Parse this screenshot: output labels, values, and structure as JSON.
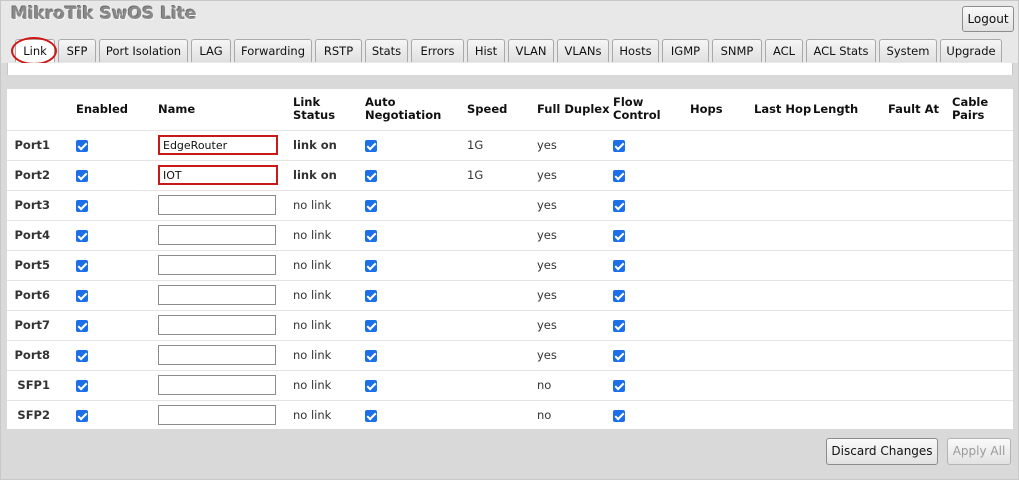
{
  "app": {
    "title": "MikroTik SwOS Lite",
    "logout_label": "Logout"
  },
  "tabs": [
    {
      "label": "Link",
      "active": true
    },
    {
      "label": "SFP"
    },
    {
      "label": "Port Isolation"
    },
    {
      "label": "LAG"
    },
    {
      "label": "Forwarding"
    },
    {
      "label": "RSTP"
    },
    {
      "label": "Stats"
    },
    {
      "label": "Errors"
    },
    {
      "label": "Hist"
    },
    {
      "label": "VLAN"
    },
    {
      "label": "VLANs"
    },
    {
      "label": "Hosts"
    },
    {
      "label": "IGMP"
    },
    {
      "label": "SNMP"
    },
    {
      "label": "ACL"
    },
    {
      "label": "ACL Stats"
    },
    {
      "label": "System"
    },
    {
      "label": "Upgrade"
    }
  ],
  "table": {
    "columns": {
      "enabled": "Enabled",
      "name": "Name",
      "link_status": "Link Status",
      "auto_negotiation": "Auto Negotiation",
      "speed": "Speed",
      "full_duplex": "Full Duplex",
      "flow_control": "Flow Control",
      "hops": "Hops",
      "last_hop": "Last Hop",
      "length": "Length",
      "fault_at": "Fault At",
      "cable_pairs": "Cable Pairs"
    },
    "rows": [
      {
        "port": "Port1",
        "enabled": true,
        "name": "EdgeRouter",
        "link_status": "link on",
        "auto_negotiation": true,
        "speed": "1G",
        "full_duplex": "yes",
        "flow_control": true
      },
      {
        "port": "Port2",
        "enabled": true,
        "name": "IOT",
        "link_status": "link on",
        "auto_negotiation": true,
        "speed": "1G",
        "full_duplex": "yes",
        "flow_control": true
      },
      {
        "port": "Port3",
        "enabled": true,
        "name": "",
        "link_status": "no link",
        "auto_negotiation": true,
        "speed": "",
        "full_duplex": "yes",
        "flow_control": true
      },
      {
        "port": "Port4",
        "enabled": true,
        "name": "",
        "link_status": "no link",
        "auto_negotiation": true,
        "speed": "",
        "full_duplex": "yes",
        "flow_control": true
      },
      {
        "port": "Port5",
        "enabled": true,
        "name": "",
        "link_status": "no link",
        "auto_negotiation": true,
        "speed": "",
        "full_duplex": "yes",
        "flow_control": true
      },
      {
        "port": "Port6",
        "enabled": true,
        "name": "",
        "link_status": "no link",
        "auto_negotiation": true,
        "speed": "",
        "full_duplex": "yes",
        "flow_control": true
      },
      {
        "port": "Port7",
        "enabled": true,
        "name": "",
        "link_status": "no link",
        "auto_negotiation": true,
        "speed": "",
        "full_duplex": "yes",
        "flow_control": true
      },
      {
        "port": "Port8",
        "enabled": true,
        "name": "",
        "link_status": "no link",
        "auto_negotiation": true,
        "speed": "",
        "full_duplex": "yes",
        "flow_control": true
      },
      {
        "port": "SFP1",
        "enabled": true,
        "name": "",
        "link_status": "no link",
        "auto_negotiation": true,
        "speed": "",
        "full_duplex": "no",
        "flow_control": true
      },
      {
        "port": "SFP2",
        "enabled": true,
        "name": "",
        "link_status": "no link",
        "auto_negotiation": true,
        "speed": "",
        "full_duplex": "no",
        "flow_control": true
      }
    ]
  },
  "footer": {
    "discard_label": "Discard Changes",
    "apply_label": "Apply All"
  },
  "colors": {
    "checkbox": "#1d6fe8",
    "highlight": "#c81818",
    "title": "#8a8a8a"
  }
}
